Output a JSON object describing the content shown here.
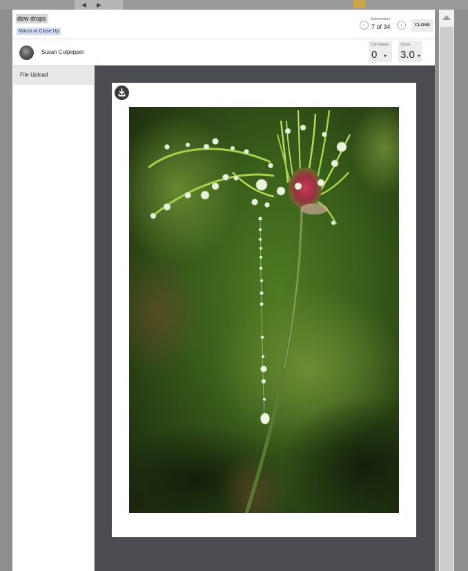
{
  "submission": {
    "title": "dew drops",
    "category": "Macro or Close Up",
    "nav_label": "Submission",
    "position": "7 of 34",
    "prev_icon": "chevron-left-icon",
    "next_icon": "chevron-right-icon",
    "close_label": "CLOSE"
  },
  "author": {
    "name": "Susan Culpepper"
  },
  "metrics": {
    "comments_label": "Comments",
    "comments_value": "0",
    "score_label": "Score",
    "score_value": "3.0"
  },
  "sidebar": {
    "items": [
      {
        "label": "File Upload"
      }
    ]
  },
  "viewer": {
    "download_icon": "download-icon"
  },
  "colors": {
    "viewer_bg": "#4a4c51",
    "category_highlight": "#cfdcf4",
    "title_highlight": "#d6d6d6"
  }
}
